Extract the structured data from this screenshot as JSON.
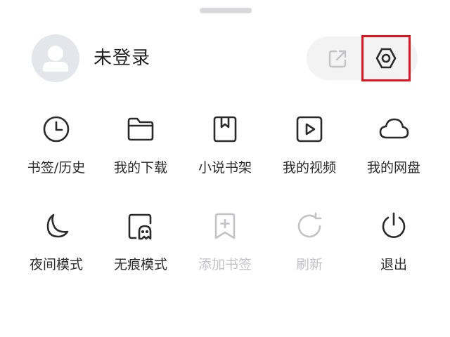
{
  "header": {
    "login_label": "未登录",
    "avatar_icon": "user-avatar-icon",
    "share_icon": "external-share-icon",
    "settings_icon": "settings-hexagon-icon",
    "highlight_color": "#e0141e"
  },
  "row1": [
    {
      "label": "书签/历史",
      "icon": "clock-icon",
      "enabled": true
    },
    {
      "label": "我的下载",
      "icon": "folder-icon",
      "enabled": true
    },
    {
      "label": "小说书架",
      "icon": "book-bookmark-icon",
      "enabled": true
    },
    {
      "label": "我的视频",
      "icon": "play-video-icon",
      "enabled": true
    },
    {
      "label": "我的网盘",
      "icon": "cloud-icon",
      "enabled": true
    }
  ],
  "row2": [
    {
      "label": "夜间模式",
      "icon": "moon-icon",
      "enabled": true
    },
    {
      "label": "无痕模式",
      "icon": "ghost-incognito-icon",
      "enabled": true
    },
    {
      "label": "添加书签",
      "icon": "add-bookmark-icon",
      "enabled": false
    },
    {
      "label": "刷新",
      "icon": "refresh-icon",
      "enabled": false
    },
    {
      "label": "退出",
      "icon": "power-icon",
      "enabled": true
    }
  ],
  "colors": {
    "icon_active": "#2a2a2a",
    "icon_disabled": "#c3c3c6",
    "avatar_bg": "#e3e6ea",
    "pill_bg": "#f3f3f4"
  }
}
